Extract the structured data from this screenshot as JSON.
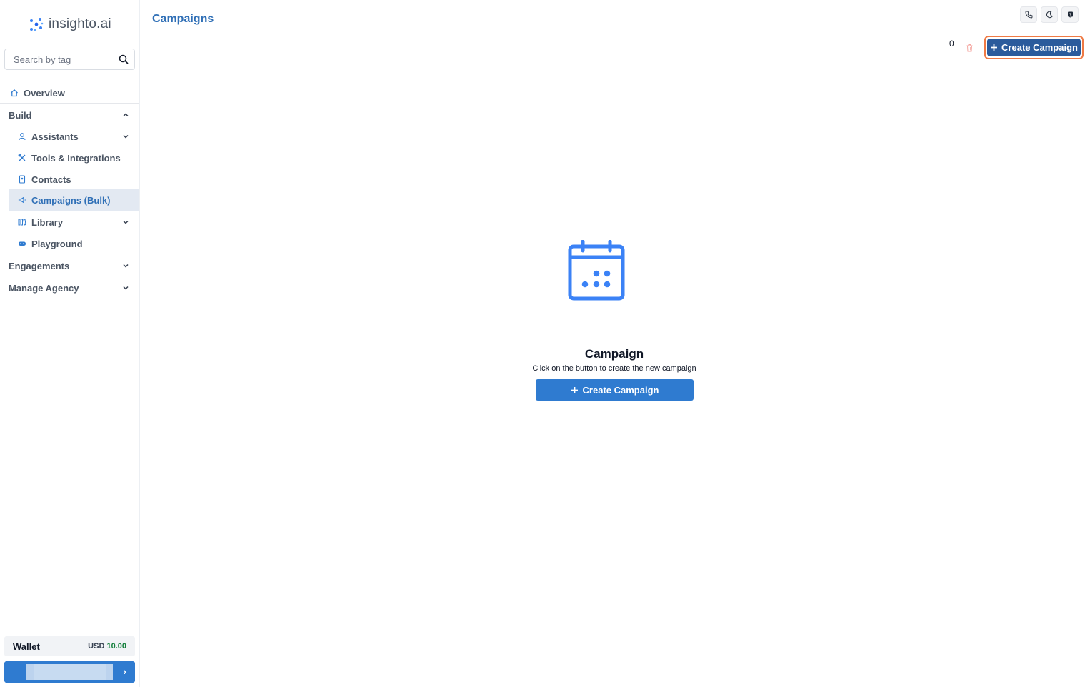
{
  "brand": {
    "name": "insighto.ai"
  },
  "search": {
    "placeholder": "Search by tag"
  },
  "nav": {
    "overview": "Overview",
    "build": "Build",
    "assistants": "Assistants",
    "tools": "Tools & Integrations",
    "contacts": "Contacts",
    "campaigns": "Campaigns (Bulk)",
    "library": "Library",
    "playground": "Playground",
    "engagements": "Engagements",
    "manage_agency": "Manage Agency"
  },
  "wallet": {
    "label": "Wallet",
    "currency": "USD",
    "amount": "10.00"
  },
  "header": {
    "title": "Campaigns"
  },
  "toolbar": {
    "selected_count": "0",
    "create_label": "Create Campaign"
  },
  "empty_state": {
    "title": "Campaign",
    "subtitle": "Click on the button to create the new campaign",
    "button_label": "Create Campaign"
  },
  "colors": {
    "primary": "#2f7bd0",
    "accent_dark": "#2b5b9c",
    "highlight": "#ef7a45",
    "active_text": "#2f6fb6",
    "wallet_amount": "#15803d"
  }
}
